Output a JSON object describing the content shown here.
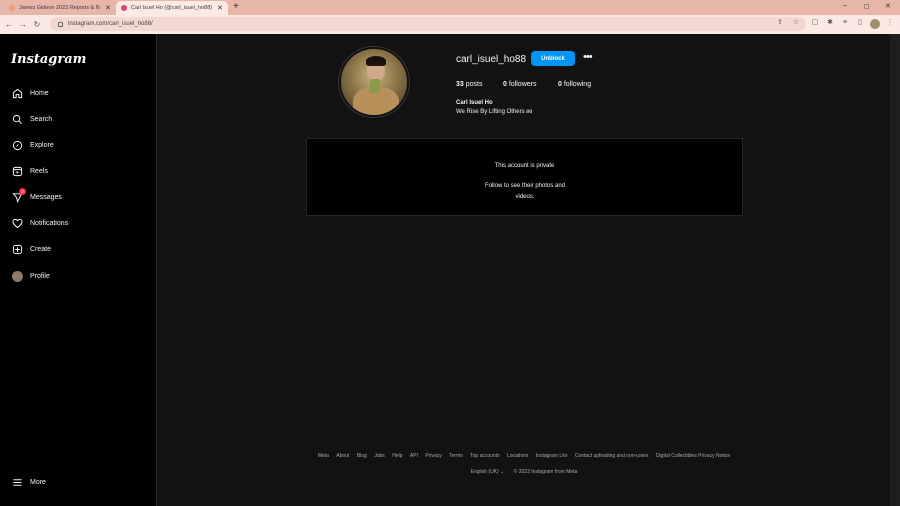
{
  "browser": {
    "tabs": [
      {
        "title": "James Gideon 2023 Reports & N",
        "active": false,
        "favicon_color": "#e7a07a"
      },
      {
        "title": "Carl Isuel Ho (@carl_isuel_ho88)",
        "active": true,
        "favicon_color": "#d9467a"
      }
    ],
    "new_tab": "+",
    "window_controls": {
      "minimize": "–",
      "maximize": "◻",
      "close": "✕"
    },
    "url": "instagram.com/carl_isuel_ho88/"
  },
  "sidebar": {
    "logo": "Instagram",
    "items": [
      {
        "label": "Home",
        "icon": "home-icon"
      },
      {
        "label": "Search",
        "icon": "search-icon"
      },
      {
        "label": "Explore",
        "icon": "compass-icon"
      },
      {
        "label": "Reels",
        "icon": "reels-icon"
      },
      {
        "label": "Messages",
        "icon": "messages-icon",
        "badge": "2"
      },
      {
        "label": "Notifications",
        "icon": "heart-icon"
      },
      {
        "label": "Create",
        "icon": "plus-square-icon"
      },
      {
        "label": "Profile",
        "icon": "profile-avatar"
      }
    ],
    "more": "More"
  },
  "profile": {
    "username": "carl_isuel_ho88",
    "unblock_label": "Unblock",
    "more_label": "•••",
    "posts_count": "33",
    "posts_label": "posts",
    "followers_count": "0",
    "followers_label": "followers",
    "following_count": "0",
    "following_label": "following",
    "full_name": "Carl Isuel Ho",
    "bio": "We Rise By Lifting Others ʚɞ"
  },
  "private": {
    "title": "This account is private",
    "subtitle": "Follow to see their photos and videos."
  },
  "footer": {
    "links": [
      "Meta",
      "About",
      "Blog",
      "Jobs",
      "Help",
      "API",
      "Privacy",
      "Terms",
      "Top accounts",
      "Locations",
      "Instagram Lite",
      "Contact uploading and non-users",
      "Digital Collectibles Privacy Notice"
    ],
    "language": "English (UK) ⌄",
    "copyright": "© 2023 Instagram from Meta"
  },
  "colors": {
    "accent": "#0095f6",
    "badge": "#ff3040",
    "background": "#121212",
    "tabbar": "#e8b6a9"
  }
}
